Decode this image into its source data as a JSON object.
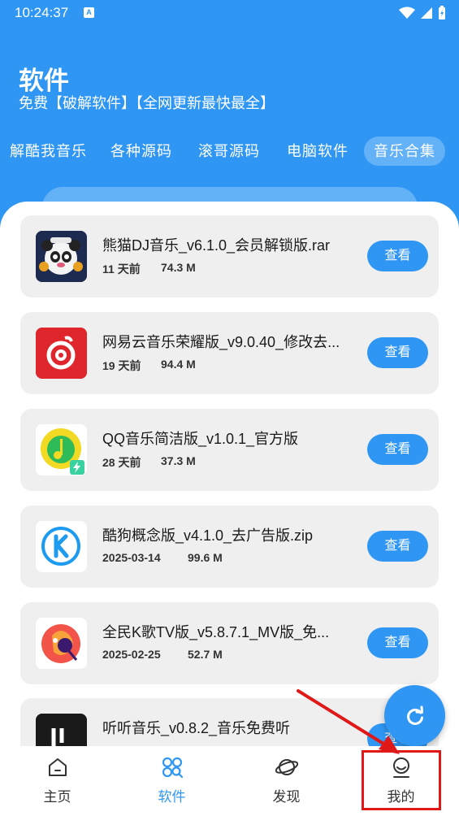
{
  "status_bar": {
    "time": "10:24:37",
    "notif_letter": "A"
  },
  "header": {
    "title": "软件",
    "subtitle": "免费【破解软件】【全网更新最快最全】"
  },
  "tabs": [
    {
      "label": "解酷我音乐",
      "active": false
    },
    {
      "label": "各种源码",
      "active": false
    },
    {
      "label": "滚哥源码",
      "active": false
    },
    {
      "label": "电脑软件",
      "active": false
    },
    {
      "label": "音乐合集",
      "active": true
    }
  ],
  "items": [
    {
      "title": "熊猫DJ音乐_v6.1.0_会员解锁版.rar",
      "date": "11 天前",
      "size": "74.3 M",
      "button": "查看",
      "icon": "panda-dj-icon"
    },
    {
      "title": "网易云音乐荣耀版_v9.0.40_修改去...",
      "date": "19 天前",
      "size": "94.4 M",
      "button": "查看",
      "icon": "netease-music-icon"
    },
    {
      "title": "QQ音乐简洁版_v1.0.1_官方版",
      "date": "28 天前",
      "size": "37.3 M",
      "button": "查看",
      "icon": "qq-music-icon"
    },
    {
      "title": "酷狗概念版_v4.1.0_去广告版.zip",
      "date": "2025-03-14",
      "size": "99.6 M",
      "button": "查看",
      "icon": "kugou-icon"
    },
    {
      "title": "全民K歌TV版_v5.8.7.1_MV版_免...",
      "date": "2025-02-25",
      "size": "52.7 M",
      "button": "查看",
      "icon": "wesing-icon"
    },
    {
      "title": "听听音乐_v0.8.2_音乐免费听",
      "date": "",
      "size": "",
      "button": "查看",
      "icon": "tingting-icon"
    }
  ],
  "bottom_nav": [
    {
      "label": "主页",
      "icon": "home-icon",
      "active": false
    },
    {
      "label": "软件",
      "icon": "apps-icon",
      "active": true
    },
    {
      "label": "发现",
      "icon": "planet-icon",
      "active": false
    },
    {
      "label": "我的",
      "icon": "profile-icon",
      "active": false
    }
  ],
  "colors": {
    "primary": "#2f97f3",
    "card": "#efefef",
    "annotation": "#e01818"
  }
}
